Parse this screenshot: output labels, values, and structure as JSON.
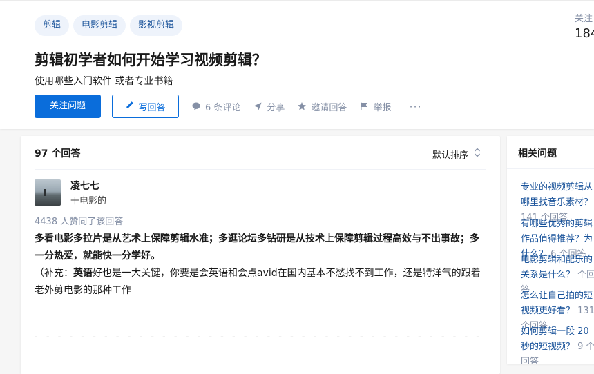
{
  "tags": [
    "剪辑",
    "电影剪辑",
    "影视剪辑"
  ],
  "question": {
    "title": "剪辑初学者如何开始学习视频剪辑？",
    "detail": "使用哪些入门软件 或者专业书籍"
  },
  "side_stat": {
    "label": "关注",
    "value": "184"
  },
  "actions": {
    "follow_label": "关注问题",
    "answer_label": "写回答",
    "comments_label": "6 条评论",
    "share_label": "分享",
    "invite_label": "邀请回答",
    "report_label": "举报",
    "more_label": "···"
  },
  "answers": {
    "count_label": "97 个回答",
    "sort_label": "默认排序"
  },
  "answer": {
    "author": "凌七七",
    "bio": "干电影的",
    "votes": "4438 人赞同了该回答",
    "para1": "多看电影多拉片是从艺术上保障剪辑水准；多逛论坛多钻研是从技术上保障剪辑过程高效与不出事故；多一分热爱，就能快一分学好。",
    "para2_prefix": "（补充：",
    "para2_bold": "英语",
    "para2_rest": "好也是一大关键，你要是会英语和会点avid在国内基本不愁找不到工作，还是特洋气的跟着老外剪电影的那种工作",
    "divider": "- - - - - - - - - - - - - - - - - - - - - - - - - - - - - - - - - - - - - - -"
  },
  "related": {
    "title": "相关问题",
    "items": [
      {
        "question": "专业的视频剪辑从哪里找音乐素材？",
        "count": "141 个回答"
      },
      {
        "question": "有哪些优秀的剪辑作品值得推荐？为什么？",
        "count": "6 个回答"
      },
      {
        "question": "电影剪辑和配乐的关系是什么？",
        "count": "个回答"
      },
      {
        "question": "怎么让自己拍的短视频更好看？",
        "count": "131 个回答"
      },
      {
        "question": "如何剪辑一段 20 秒的短视频？",
        "count": "9 个回答"
      }
    ]
  },
  "colors": {
    "primary": "#0a6ddb",
    "link": "#175199",
    "muted": "#8590a6",
    "tag_bg": "#eef3fb"
  },
  "icons": [
    "pen-icon",
    "comment-icon",
    "share-icon",
    "invite-icon",
    "report-icon",
    "sort-icon"
  ]
}
